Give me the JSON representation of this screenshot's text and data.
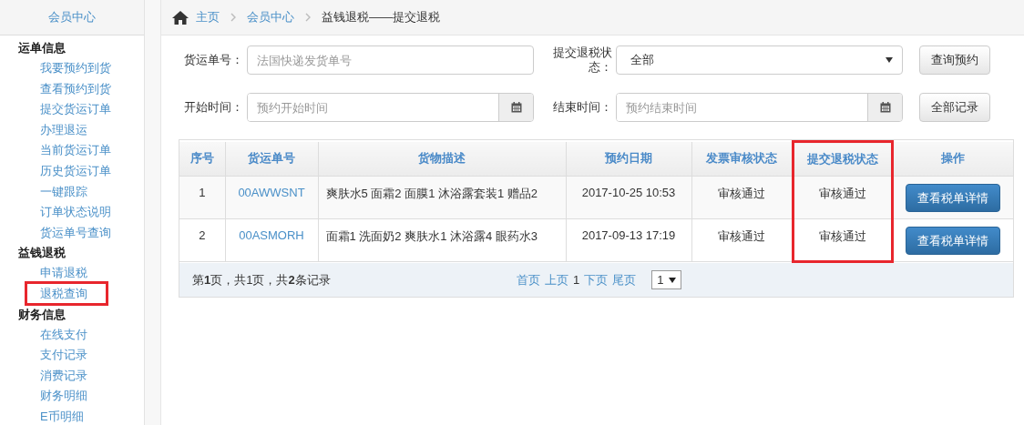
{
  "sidebar": {
    "title": "会员中心",
    "groups": [
      {
        "title": "运单信息",
        "items": [
          {
            "label": "我要预约到货",
            "highlighted": false
          },
          {
            "label": "查看预约到货",
            "highlighted": false
          },
          {
            "label": "提交货运订单",
            "highlighted": false
          },
          {
            "label": "办理退运",
            "highlighted": false
          },
          {
            "label": "当前货运订单",
            "highlighted": false
          },
          {
            "label": "历史货运订单",
            "highlighted": false
          },
          {
            "label": "一键跟踪",
            "highlighted": false
          },
          {
            "label": "订单状态说明",
            "highlighted": false
          },
          {
            "label": "货运单号查询",
            "highlighted": false
          }
        ]
      },
      {
        "title": "益钱退税",
        "items": [
          {
            "label": "申请退税",
            "highlighted": false
          },
          {
            "label": "退税查询",
            "highlighted": true
          }
        ]
      },
      {
        "title": "财务信息",
        "items": [
          {
            "label": "在线支付",
            "highlighted": false
          },
          {
            "label": "支付记录",
            "highlighted": false
          },
          {
            "label": "消费记录",
            "highlighted": false
          },
          {
            "label": "财务明细",
            "highlighted": false
          },
          {
            "label": "E币明细",
            "highlighted": false
          }
        ]
      }
    ]
  },
  "breadcrumb": {
    "links": [
      "主页",
      "会员中心"
    ],
    "current": "益钱退税——提交退税"
  },
  "filters": {
    "waybill": {
      "label": "货运单号：",
      "placeholder": "法国快递发货单号"
    },
    "status": {
      "label": "提交退税状态：",
      "value": "全部"
    },
    "query_button": "查询预约",
    "start": {
      "label": "开始时间：",
      "placeholder": "预约开始时间"
    },
    "end": {
      "label": "结束时间：",
      "placeholder": "预约结束时间"
    },
    "all_button": "全部记录"
  },
  "table": {
    "columns": [
      {
        "label": "序号",
        "highlighted": false
      },
      {
        "label": "货运单号",
        "highlighted": false
      },
      {
        "label": "货物描述",
        "highlighted": false
      },
      {
        "label": "预约日期",
        "highlighted": false
      },
      {
        "label": "发票审核状态",
        "highlighted": false
      },
      {
        "label": "提交退税状态",
        "highlighted": true
      },
      {
        "label": "操作",
        "highlighted": false
      }
    ],
    "rows": [
      {
        "no": "1",
        "waybill": "00AWWSNT",
        "goods": "爽肤水5 面霜2 面膜1 沐浴露套装1 赠品2",
        "date": "2017-10-25 10:53",
        "invoice_status": "审核通过",
        "refund_status": "审核通过",
        "action": "查看税单详情"
      },
      {
        "no": "2",
        "waybill": "00ASMORH",
        "goods": "面霜1 洗面奶2 爽肤水1 沐浴露4 眼药水3",
        "date": "2017-09-13 17:19",
        "invoice_status": "审核通过",
        "refund_status": "审核通过",
        "action": "查看税单详情"
      }
    ]
  },
  "pager": {
    "info": "第**1**页，共1页，共**2**条记录",
    "links": [
      "首页",
      "上页"
    ],
    "current": "1",
    "links_after": [
      "下页",
      "尾页"
    ],
    "page_select": "1"
  }
}
